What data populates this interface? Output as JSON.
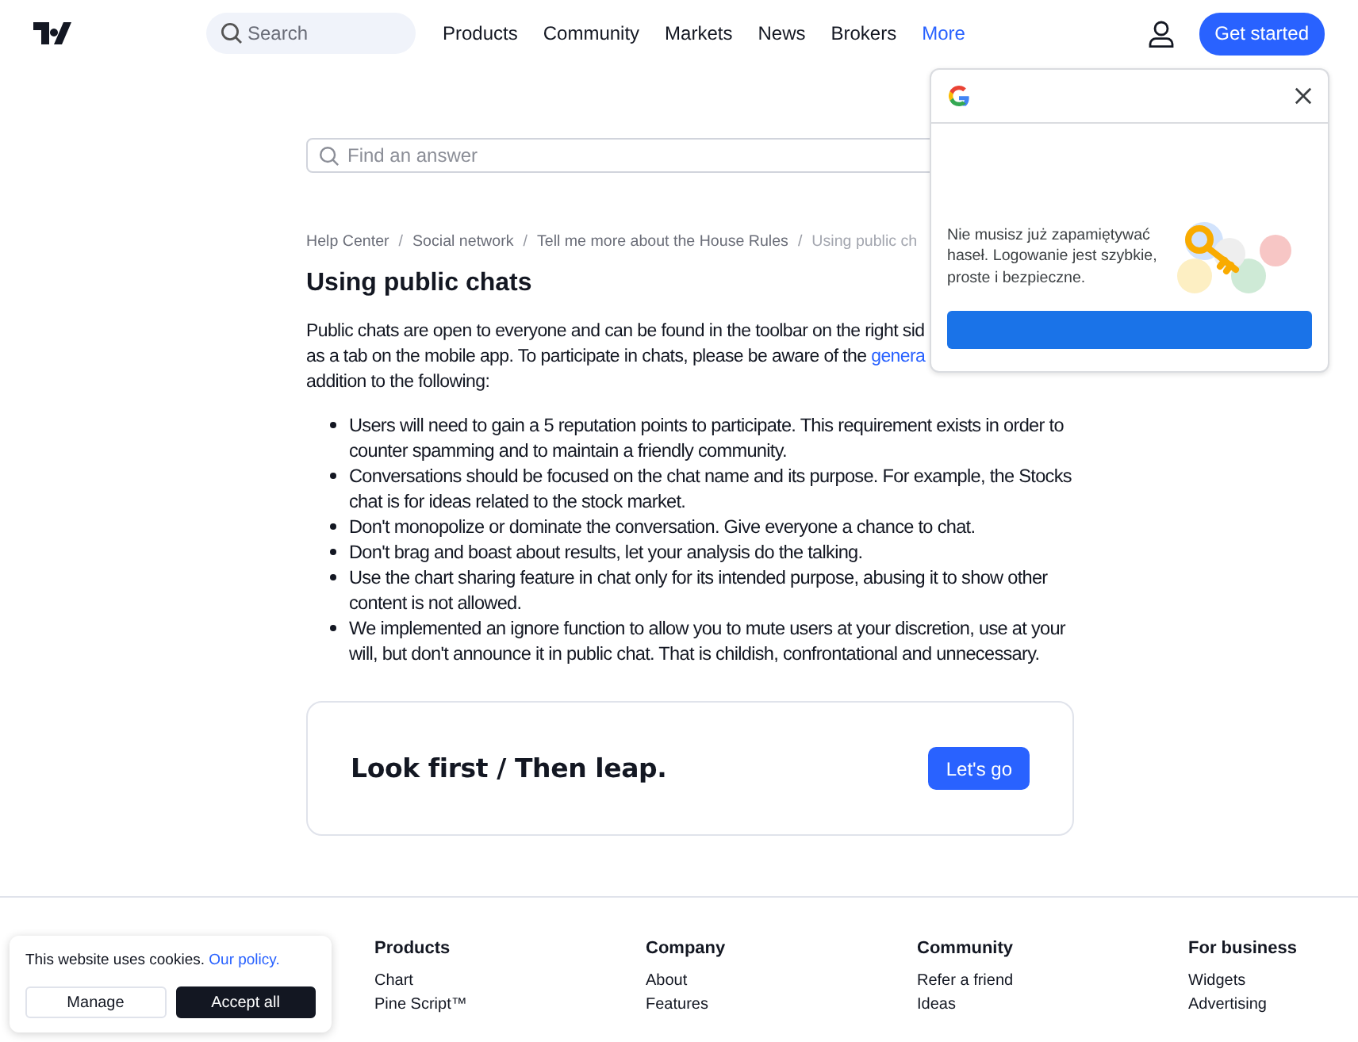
{
  "header": {
    "search": {
      "placeholder": "Search"
    },
    "nav": [
      {
        "label": "Products",
        "selected": false
      },
      {
        "label": "Community",
        "selected": false
      },
      {
        "label": "Markets",
        "selected": false
      },
      {
        "label": "News",
        "selected": false
      },
      {
        "label": "Brokers",
        "selected": false
      },
      {
        "label": "More",
        "selected": true
      }
    ],
    "cta": "Get started"
  },
  "help_search": {
    "placeholder": "Find an answer"
  },
  "breadcrumb_separator": "/",
  "breadcrumbs": [
    {
      "label": "Help Center",
      "current": false
    },
    {
      "label": "Social network",
      "current": false
    },
    {
      "label": "Tell me more about the House Rules",
      "current": false
    },
    {
      "label": "Using public ch",
      "current": true
    }
  ],
  "article": {
    "title": "Using public chats",
    "intro": [
      {
        "text": "Public chats are open to everyone and can be found in the toolbar on the right sid"
      },
      {
        "text": "as a tab on the mobile app. To participate in chats, please be aware of the ",
        "link": "genera"
      },
      {
        "text": "addition to the following:"
      }
    ],
    "rules": [
      "Users will need to gain a 5 reputation points to participate. This requirement exists in order to counter spamming and to maintain a friendly community.",
      "Conversations should be focused on the chat name and its purpose. For example, the Stocks chat is for ideas related to the stock market.",
      "Don't monopolize or dominate the conversation. Give everyone a chance to chat.",
      "Don't brag and boast about results, let your analysis do the talking.",
      "Use the chart sharing feature in chat only for its intended purpose, abusing it to show other content is not allowed.",
      "We implemented an ignore function to allow you to mute users at your discretion, use at your will, but don't announce it in public chat. That is childish, confrontational and unnecessary."
    ]
  },
  "promo": {
    "slogan": "Look first / Then leap.",
    "button": "Let's go"
  },
  "google_popup": {
    "message": "Nie musisz już zapamiętywać haseł. Logowanie jest szybkie, proste i bezpieczne."
  },
  "footer": {
    "columns": [
      {
        "heading": "Products",
        "links": [
          "Chart",
          "Pine Script™"
        ]
      },
      {
        "heading": "Company",
        "links": [
          "About",
          "Features"
        ]
      },
      {
        "heading": "Community",
        "links": [
          "Refer a friend",
          "Ideas"
        ]
      },
      {
        "heading": "For business",
        "links": [
          "Widgets",
          "Advertising"
        ]
      }
    ]
  },
  "cookie_banner": {
    "text": "This website uses cookies.",
    "link": "Our policy.",
    "buttons": [
      {
        "label": "Manage",
        "kind": "secondary"
      },
      {
        "label": "Accept all",
        "kind": "primary"
      }
    ]
  }
}
